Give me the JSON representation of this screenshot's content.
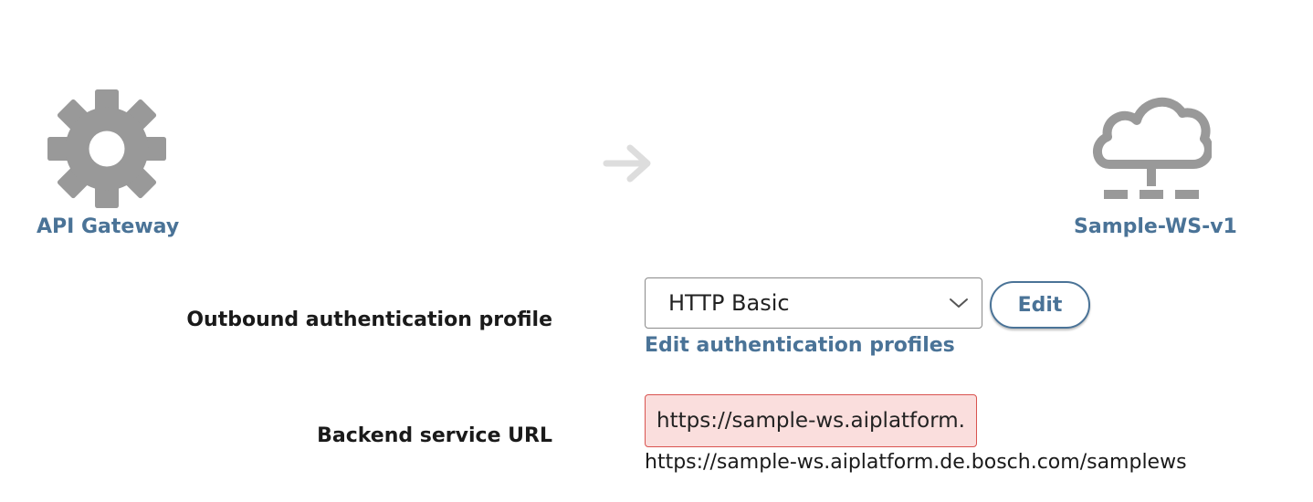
{
  "flow": {
    "source_label": "API Gateway",
    "source_icon": "gear-icon",
    "connector_icon": "arrow-right-icon",
    "target_label": "Sample-WS-v1",
    "target_icon": "cloud-network-icon"
  },
  "auth": {
    "label": "Outbound authentication profile",
    "selected_profile": "HTTP Basic",
    "edit_button": "Edit",
    "edit_profiles_link": "Edit authentication profiles"
  },
  "backend": {
    "label": "Backend service URL",
    "url_value": "https://sample-ws.aiplatform.de.bosch.com/samplews",
    "url_display": "https://sample-ws.aiplatform.de.bosch.com/samplews"
  },
  "colors": {
    "accent": "#4a7397",
    "icon_gray": "#999999",
    "arrow_gray": "#dddddd",
    "error_border": "#d9534f",
    "error_bg": "#fadedd"
  }
}
